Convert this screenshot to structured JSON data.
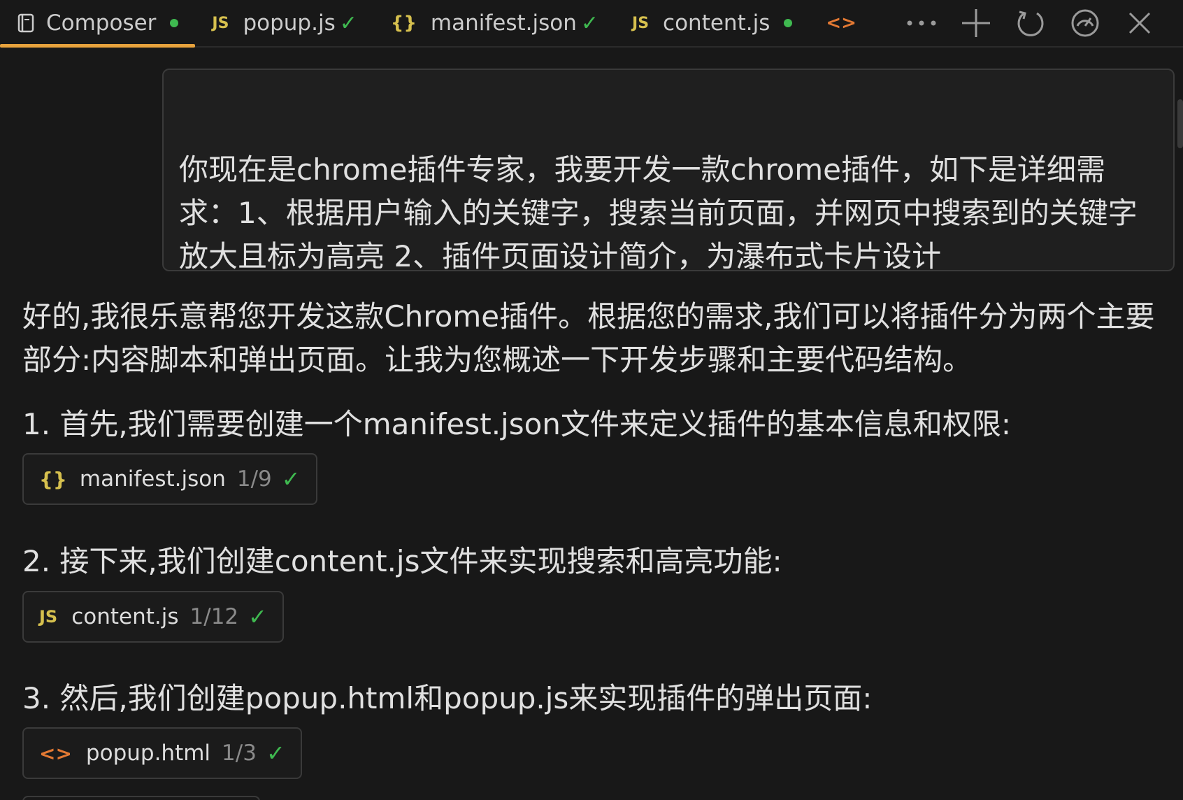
{
  "tabs": [
    {
      "label": "Composer",
      "icon": "document-icon",
      "status": "dot",
      "active": true
    },
    {
      "label": "popup.js",
      "icon_text": "JS",
      "status": "check"
    },
    {
      "label": "manifest.json",
      "icon_text": "{}",
      "status": "check"
    },
    {
      "label": "content.js",
      "icon_text": "JS",
      "status": "dot"
    },
    {
      "label": "",
      "icon_text": "<>",
      "status": ""
    }
  ],
  "status_check": "✓",
  "toolbar": [
    "more-icon",
    "plus-icon",
    "refresh-icon",
    "gauge-icon",
    "close-icon"
  ],
  "colors": {
    "accent": "#e8a33d",
    "success": "#3fb950",
    "js": "#d6c04e",
    "html": "#e37933"
  },
  "user_prompt": "你现在是chrome插件专家，我要开发一款chrome插件，如下是详细需求：1、根据用户输入的关键字，搜索当前页面，并网页中搜索到的关键字放大且标为高亮  2、插件页面设计简介，为瀑布式卡片设计",
  "response": {
    "intro": "好的,我很乐意帮您开发这款Chrome插件。根据您的需求,我们可以将插件分为两个主要部分:内容脚本和弹出页面。让我为您概述一下开发步骤和主要代码结构。",
    "step1": "1. 首先,我们需要创建一个manifest.json文件来定义插件的基本信息和权限:",
    "step2": "2. 接下来,我们创建content.js文件来实现搜索和高亮功能:",
    "step3": "3. 然后,我们创建popup.html和popup.js来实现插件的弹出页面:"
  },
  "files": [
    {
      "icon_text": "{}",
      "name": "manifest.json",
      "count": "1/9",
      "check": "✓"
    },
    {
      "icon_text": "JS",
      "name": "content.js",
      "count": "1/12",
      "check": "✓"
    },
    {
      "icon_text": "<>",
      "name": "popup.html",
      "count": "1/3",
      "check": "✓"
    }
  ]
}
